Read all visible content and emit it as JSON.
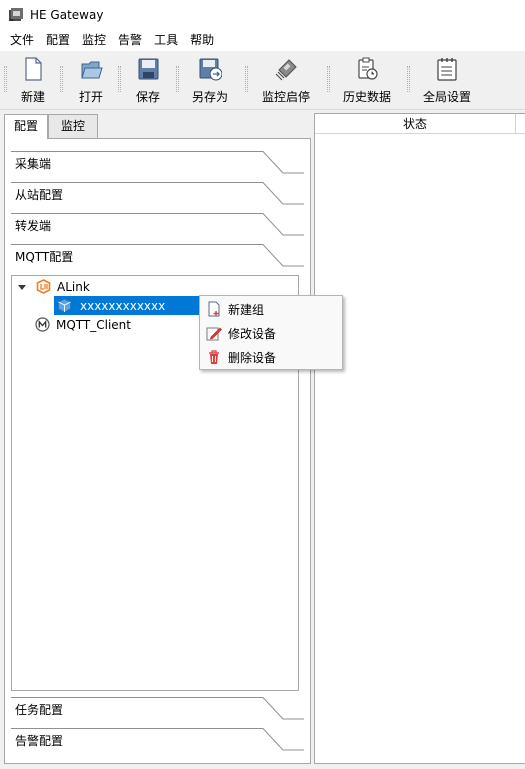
{
  "window": {
    "title": "HE Gateway"
  },
  "menubar": {
    "items": [
      "文件",
      "配置",
      "监控",
      "告警",
      "工具",
      "帮助"
    ]
  },
  "toolbar": {
    "buttons": [
      {
        "label": "新建",
        "icon": "new-file-icon"
      },
      {
        "label": "打开",
        "icon": "open-folder-icon"
      },
      {
        "label": "保存",
        "icon": "save-icon"
      },
      {
        "label": "另存为",
        "icon": "save-as-icon"
      },
      {
        "label": "监控启停",
        "icon": "monitor-icon"
      },
      {
        "label": "历史数据",
        "icon": "history-icon"
      },
      {
        "label": "全局设置",
        "icon": "settings-icon"
      }
    ]
  },
  "tabs": {
    "config": "配置",
    "monitor": "监控",
    "active": "配置"
  },
  "sections": {
    "collect": "采集端",
    "slave": "从站配置",
    "forward": "转发端",
    "mqtt": "MQTT配置",
    "task": "任务配置",
    "alarm": "告警配置"
  },
  "tree": {
    "alink": "ALink",
    "alink_child": "xxxxxxxxxxxx",
    "mqtt_client": "MQTT_Client"
  },
  "right_panel": {
    "column_header": "状态"
  },
  "context_menu": {
    "items": [
      {
        "label": "新建组",
        "icon": "new-group-icon"
      },
      {
        "label": "修改设备",
        "icon": "edit-icon"
      },
      {
        "label": "删除设备",
        "icon": "trash-icon"
      }
    ]
  },
  "colors": {
    "selection": "#0078d7",
    "accent_orange": "#f07c1c",
    "delete_red": "#e03c3c"
  }
}
